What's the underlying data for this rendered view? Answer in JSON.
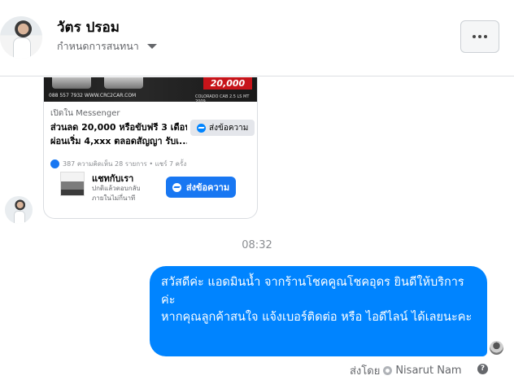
{
  "header": {
    "name": "วัตร ปรอม",
    "subtitle": "กำหนดการสนทนา",
    "more_label": "..."
  },
  "shared_post": {
    "price_badge": "20,000",
    "phone": "088 557 7932 WWW.CRC2CAR.COM",
    "model": "COLORADO CAB 2.5 LS MT 2009",
    "open_in": "เปิดใน Messenger",
    "title_line1": "ส่วนลด 20,000 หรือขับฟรี 3 เดือน",
    "title_line2": "ผ่อนเริ่ม 4,xxx ตลอดสัญญา รับเ...",
    "send_small_label": "ส่งข้อความ",
    "stats": "387   ความคิดเห็น 28 รายการ • แชร์ 7 ครั้ง",
    "chat_title": "แชทกับเรา",
    "chat_sub_line1": "ปกติแล้วตอบกลับ",
    "chat_sub_line2": "ภายในไม่กี่นาที",
    "send_big_label": "ส่งข้อความ"
  },
  "timestamp": "08:32",
  "message": {
    "text": "สวัสดีค่ะ แอดมินน้ำ จากร้านโชคคูณโชคอุดร ยินดีให้บริการค่ะ\nหากคุณลูกค้าสนใจ แจ้งเบอร์ติดต่อ หรือ ไอดีไลน์ ได้เลยนะคะ"
  },
  "footer": {
    "sent_by_label": "ส่งโดย",
    "sender_name": "Nisarut Nam",
    "help": "?"
  },
  "colors": {
    "bubble": "#0084ff",
    "messenger_blue": "#1877f2",
    "price_red": "#c7141a"
  }
}
